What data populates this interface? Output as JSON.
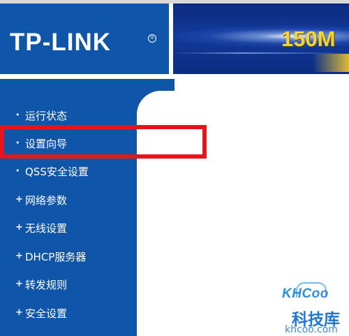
{
  "header": {
    "brand": "TP-LINK",
    "registered_mark": "®",
    "model_banner": "150M"
  },
  "sidebar": {
    "items": [
      {
        "label": "运行状态",
        "marker": "•"
      },
      {
        "label": "设置向导",
        "marker": "•"
      },
      {
        "label": "QSS安全设置",
        "marker": "•"
      },
      {
        "label": "网络参数",
        "marker": "+"
      },
      {
        "label": "无线设置",
        "marker": "+"
      },
      {
        "label": "DHCP服务器",
        "marker": "+"
      },
      {
        "label": "转发规则",
        "marker": "+"
      },
      {
        "label": "安全设置",
        "marker": "+"
      }
    ]
  },
  "watermark": {
    "logo": "KHCoo",
    "chinese": "科技库",
    "domain": "khcoo.com"
  },
  "colors": {
    "sidebar_blue": "#0f55a8",
    "banner_navy": "#0b2b7c",
    "banner_text": "#f4d43a",
    "highlight_red": "#e8141b"
  }
}
